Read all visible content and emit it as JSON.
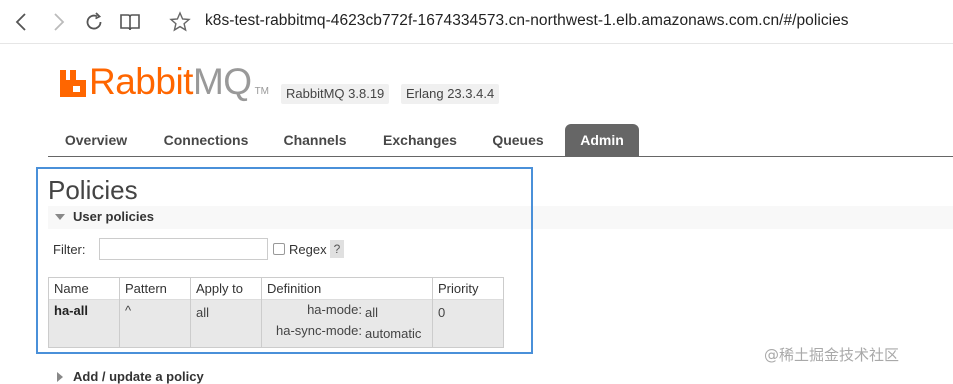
{
  "browser": {
    "url": "k8s-test-rabbitmq-4623cb772f-1674334573.cn-northwest-1.elb.amazonaws.com.cn/#/policies"
  },
  "header": {
    "logo_rabbit": "Rabbit",
    "logo_mq": "MQ",
    "logo_tm": "TM",
    "rabbitmq_version": "RabbitMQ 3.8.19",
    "erlang_version": "Erlang 23.3.4.4"
  },
  "tabs": [
    {
      "label": "Overview",
      "active": false
    },
    {
      "label": "Connections",
      "active": false
    },
    {
      "label": "Channels",
      "active": false
    },
    {
      "label": "Exchanges",
      "active": false
    },
    {
      "label": "Queues",
      "active": false
    },
    {
      "label": "Admin",
      "active": true
    }
  ],
  "main": {
    "title": "Policies",
    "user_policies": {
      "title": "User policies",
      "filter_label": "Filter:",
      "filter_value": "",
      "regex_label": "Regex",
      "regex_checked": false,
      "help": "?",
      "columns": [
        "Name",
        "Pattern",
        "Apply to",
        "Definition",
        "Priority"
      ],
      "rows": [
        {
          "name": "ha-all",
          "pattern": "^",
          "apply_to": "all",
          "definition": [
            {
              "key": "ha-mode:",
              "value": "all"
            },
            {
              "key": "ha-sync-mode:",
              "value": "automatic"
            }
          ],
          "priority": "0"
        }
      ]
    },
    "add_policy": {
      "title": "Add / update a policy"
    }
  },
  "watermark": "@稀土掘金技术社区",
  "colors": {
    "brand_orange": "#ff6600",
    "logo_gray": "#999999",
    "active_tab": "#666666",
    "highlight_border": "#4a90d9"
  }
}
